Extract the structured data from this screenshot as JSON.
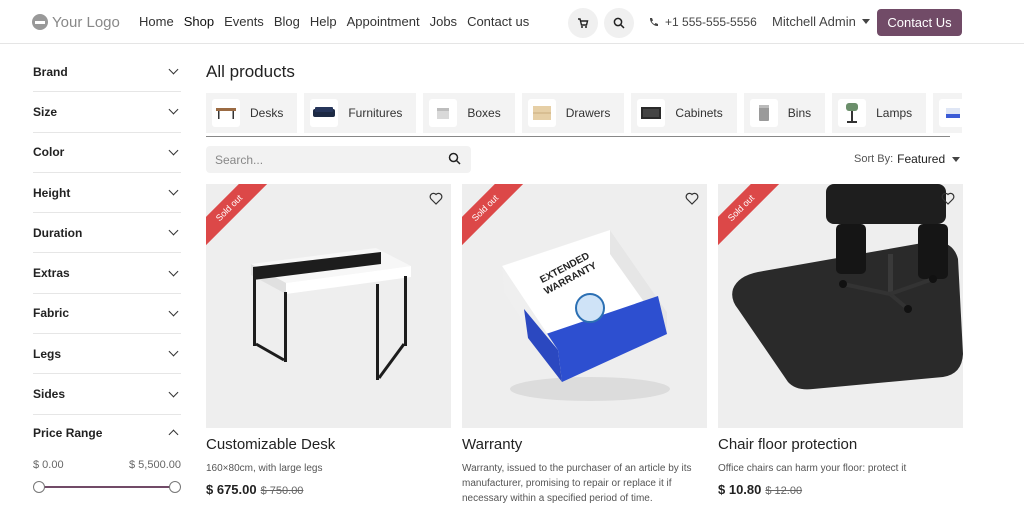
{
  "header": {
    "logo_text": "Your Logo",
    "nav": [
      "Home",
      "Shop",
      "Events",
      "Blog",
      "Help",
      "Appointment",
      "Jobs",
      "Contact us"
    ],
    "active_nav": "Shop",
    "phone": "+1 555-555-5556",
    "user": "Mitchell Admin",
    "contact_button": "Contact Us",
    "accent_color": "#714b67"
  },
  "sidebar": {
    "filters": [
      "Brand",
      "Size",
      "Color",
      "Height",
      "Duration",
      "Extras",
      "Fabric",
      "Legs",
      "Sides"
    ],
    "price_range": {
      "label": "Price Range",
      "min": "$ 0.00",
      "max": "$ 5,500.00"
    }
  },
  "main": {
    "title": "All products",
    "categories": [
      "Desks",
      "Furnitures",
      "Boxes",
      "Drawers",
      "Cabinets",
      "Bins",
      "Lamps"
    ],
    "search": {
      "placeholder": "Search..."
    },
    "sort": {
      "label": "Sort By:",
      "value": "Featured"
    },
    "products": [
      {
        "ribbon": "Sold out",
        "name": "Customizable Desk",
        "desc": "160×80cm, with large legs",
        "price": "$ 675.00",
        "old_price": "$ 750.00"
      },
      {
        "ribbon": "Sold out",
        "name": "Warranty",
        "desc": "Warranty, issued to the purchaser of an article by its manufacturer, promising to repair or replace it if necessary within a specified period of time.",
        "price": "",
        "old_price": ""
      },
      {
        "ribbon": "Sold out",
        "name": "Chair floor protection",
        "desc": "Office chairs can harm your floor: protect it",
        "price": "$ 10.80",
        "old_price": "$ 12.00"
      }
    ],
    "warranty_box_text": "EXTENDED WARRANTY"
  }
}
